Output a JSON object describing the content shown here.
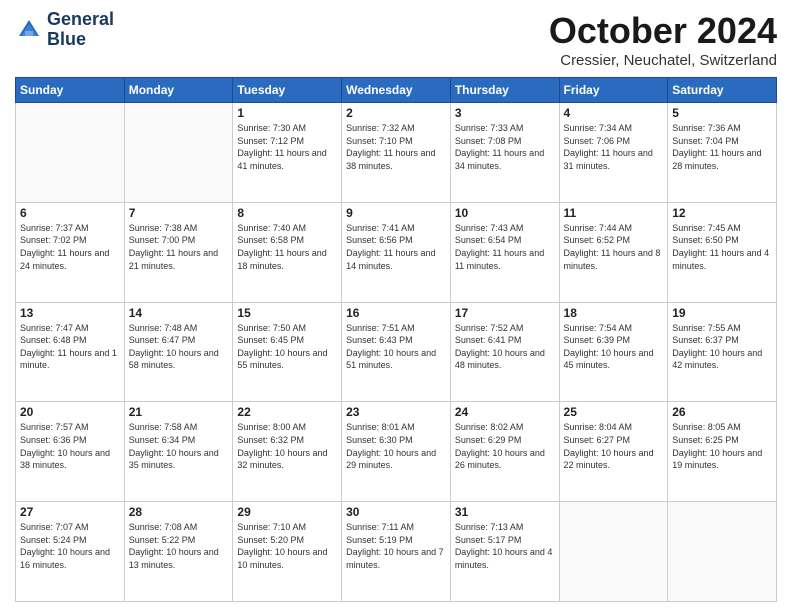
{
  "logo": {
    "line1": "General",
    "line2": "Blue"
  },
  "title": "October 2024",
  "location": "Cressier, Neuchatel, Switzerland",
  "days_header": [
    "Sunday",
    "Monday",
    "Tuesday",
    "Wednesday",
    "Thursday",
    "Friday",
    "Saturday"
  ],
  "weeks": [
    [
      {
        "day": "",
        "info": ""
      },
      {
        "day": "",
        "info": ""
      },
      {
        "day": "1",
        "info": "Sunrise: 7:30 AM\nSunset: 7:12 PM\nDaylight: 11 hours and 41 minutes."
      },
      {
        "day": "2",
        "info": "Sunrise: 7:32 AM\nSunset: 7:10 PM\nDaylight: 11 hours and 38 minutes."
      },
      {
        "day": "3",
        "info": "Sunrise: 7:33 AM\nSunset: 7:08 PM\nDaylight: 11 hours and 34 minutes."
      },
      {
        "day": "4",
        "info": "Sunrise: 7:34 AM\nSunset: 7:06 PM\nDaylight: 11 hours and 31 minutes."
      },
      {
        "day": "5",
        "info": "Sunrise: 7:36 AM\nSunset: 7:04 PM\nDaylight: 11 hours and 28 minutes."
      }
    ],
    [
      {
        "day": "6",
        "info": "Sunrise: 7:37 AM\nSunset: 7:02 PM\nDaylight: 11 hours and 24 minutes."
      },
      {
        "day": "7",
        "info": "Sunrise: 7:38 AM\nSunset: 7:00 PM\nDaylight: 11 hours and 21 minutes."
      },
      {
        "day": "8",
        "info": "Sunrise: 7:40 AM\nSunset: 6:58 PM\nDaylight: 11 hours and 18 minutes."
      },
      {
        "day": "9",
        "info": "Sunrise: 7:41 AM\nSunset: 6:56 PM\nDaylight: 11 hours and 14 minutes."
      },
      {
        "day": "10",
        "info": "Sunrise: 7:43 AM\nSunset: 6:54 PM\nDaylight: 11 hours and 11 minutes."
      },
      {
        "day": "11",
        "info": "Sunrise: 7:44 AM\nSunset: 6:52 PM\nDaylight: 11 hours and 8 minutes."
      },
      {
        "day": "12",
        "info": "Sunrise: 7:45 AM\nSunset: 6:50 PM\nDaylight: 11 hours and 4 minutes."
      }
    ],
    [
      {
        "day": "13",
        "info": "Sunrise: 7:47 AM\nSunset: 6:48 PM\nDaylight: 11 hours and 1 minute."
      },
      {
        "day": "14",
        "info": "Sunrise: 7:48 AM\nSunset: 6:47 PM\nDaylight: 10 hours and 58 minutes."
      },
      {
        "day": "15",
        "info": "Sunrise: 7:50 AM\nSunset: 6:45 PM\nDaylight: 10 hours and 55 minutes."
      },
      {
        "day": "16",
        "info": "Sunrise: 7:51 AM\nSunset: 6:43 PM\nDaylight: 10 hours and 51 minutes."
      },
      {
        "day": "17",
        "info": "Sunrise: 7:52 AM\nSunset: 6:41 PM\nDaylight: 10 hours and 48 minutes."
      },
      {
        "day": "18",
        "info": "Sunrise: 7:54 AM\nSunset: 6:39 PM\nDaylight: 10 hours and 45 minutes."
      },
      {
        "day": "19",
        "info": "Sunrise: 7:55 AM\nSunset: 6:37 PM\nDaylight: 10 hours and 42 minutes."
      }
    ],
    [
      {
        "day": "20",
        "info": "Sunrise: 7:57 AM\nSunset: 6:36 PM\nDaylight: 10 hours and 38 minutes."
      },
      {
        "day": "21",
        "info": "Sunrise: 7:58 AM\nSunset: 6:34 PM\nDaylight: 10 hours and 35 minutes."
      },
      {
        "day": "22",
        "info": "Sunrise: 8:00 AM\nSunset: 6:32 PM\nDaylight: 10 hours and 32 minutes."
      },
      {
        "day": "23",
        "info": "Sunrise: 8:01 AM\nSunset: 6:30 PM\nDaylight: 10 hours and 29 minutes."
      },
      {
        "day": "24",
        "info": "Sunrise: 8:02 AM\nSunset: 6:29 PM\nDaylight: 10 hours and 26 minutes."
      },
      {
        "day": "25",
        "info": "Sunrise: 8:04 AM\nSunset: 6:27 PM\nDaylight: 10 hours and 22 minutes."
      },
      {
        "day": "26",
        "info": "Sunrise: 8:05 AM\nSunset: 6:25 PM\nDaylight: 10 hours and 19 minutes."
      }
    ],
    [
      {
        "day": "27",
        "info": "Sunrise: 7:07 AM\nSunset: 5:24 PM\nDaylight: 10 hours and 16 minutes."
      },
      {
        "day": "28",
        "info": "Sunrise: 7:08 AM\nSunset: 5:22 PM\nDaylight: 10 hours and 13 minutes."
      },
      {
        "day": "29",
        "info": "Sunrise: 7:10 AM\nSunset: 5:20 PM\nDaylight: 10 hours and 10 minutes."
      },
      {
        "day": "30",
        "info": "Sunrise: 7:11 AM\nSunset: 5:19 PM\nDaylight: 10 hours and 7 minutes."
      },
      {
        "day": "31",
        "info": "Sunrise: 7:13 AM\nSunset: 5:17 PM\nDaylight: 10 hours and 4 minutes."
      },
      {
        "day": "",
        "info": ""
      },
      {
        "day": "",
        "info": ""
      }
    ]
  ]
}
